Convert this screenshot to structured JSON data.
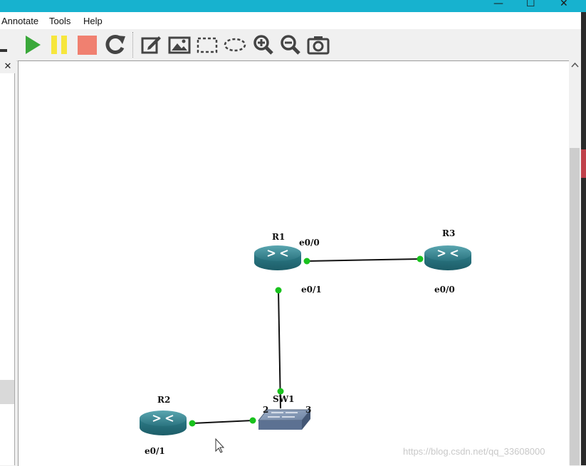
{
  "window": {
    "minimize_glyph": "—",
    "maximize_glyph": "☐",
    "close_glyph": "✕"
  },
  "menu": [
    "Annotate",
    "Tools",
    "Help"
  ],
  "toolbar": {
    "buttons": [
      "console-icon",
      "start-all-icon",
      "suspend-all-icon",
      "stop-all-icon",
      "reload-all-icon",
      "add-note-icon",
      "insert-picture-icon",
      "draw-rectangle-icon",
      "draw-ellipse-icon",
      "zoom-in-icon",
      "zoom-out-icon",
      "screenshot-icon"
    ]
  },
  "dock": {
    "close_glyph": "✕"
  },
  "topology": {
    "nodes": [
      {
        "id": "R1",
        "label": "R1",
        "type": "router"
      },
      {
        "id": "R3",
        "label": "R3",
        "type": "router"
      },
      {
        "id": "R2",
        "label": "R2",
        "type": "router"
      },
      {
        "id": "SW1",
        "label": "SW1",
        "type": "switch"
      }
    ],
    "interface_labels": {
      "r1_e0_0": "e0/0",
      "r1_e0_1": "e0/1",
      "r3_e0_0": "e0/0",
      "r2_e0_1": "e0/1",
      "sw1_port_2": "2",
      "sw1_port_3": "3"
    },
    "links": [
      {
        "from": "R1",
        "to": "R3"
      },
      {
        "from": "R1",
        "to": "SW1"
      },
      {
        "from": "R2",
        "to": "SW1"
      }
    ]
  },
  "colors": {
    "titlebar": "#17b2cf",
    "router": "#2e7f8a",
    "link_status_up": "#19c21d",
    "start": "#3aa83a",
    "suspend": "#f6e63c",
    "stop": "#f08070"
  },
  "watermark": "https://blog.csdn.net/qq_33608000"
}
